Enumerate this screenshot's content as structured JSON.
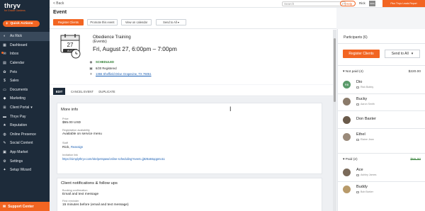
{
  "brand": {
    "logo": "thryv",
    "sub": "for Gracie Gardens"
  },
  "quick_actions": "Quick Actions",
  "nav": [
    {
      "label": "As Rick",
      "icon": "user-icon",
      "active": true
    },
    {
      "label": "Dashboard",
      "icon": "dashboard-icon",
      "active": false
    },
    {
      "label": "Inbox",
      "icon": "inbox-icon",
      "active": false,
      "badge": true
    },
    {
      "label": "Calendar",
      "icon": "calendar-icon",
      "active": false
    },
    {
      "label": "Pets",
      "icon": "paw-icon",
      "active": false
    },
    {
      "label": "Sales",
      "icon": "sales-icon",
      "active": false
    },
    {
      "label": "Documents",
      "icon": "documents-icon",
      "active": false
    },
    {
      "label": "Marketing",
      "icon": "marketing-icon",
      "active": false
    },
    {
      "label": "Client Portal",
      "icon": "portal-icon",
      "active": false,
      "caret": "▾"
    },
    {
      "label": "Thryv Pay",
      "icon": "pay-icon",
      "active": false
    },
    {
      "label": "Reputation",
      "icon": "reputation-icon",
      "active": false
    },
    {
      "label": "Online Presence",
      "icon": "presence-icon",
      "active": false
    },
    {
      "label": "Social Content",
      "icon": "social-icon",
      "active": false
    },
    {
      "label": "App Market",
      "icon": "market-icon",
      "active": false
    },
    {
      "label": "Settings",
      "icon": "gear-icon",
      "active": false
    },
    {
      "label": "Setup Wizard",
      "icon": "wizard-icon",
      "active": false
    }
  ],
  "support": "Support Center",
  "topbar": {
    "back": "< Back",
    "search_placeholder": "Search",
    "help": "? Help",
    "user": "Rick",
    "user_initials": "GMA",
    "promo": "Plus Thryv Leads Report"
  },
  "page_title": "Event",
  "header_buttons": [
    "Register Clients",
    "Promote this event",
    "View on calendar",
    "Send to All"
  ],
  "event": {
    "month": "AUG",
    "day": "27",
    "title": "Obedience Training",
    "subtitle": "(Events)",
    "date": "Fri, August 27, 6:00pm – 7:00pm",
    "status": "SCHEDULED",
    "registered": "6/20 Registered",
    "address": "1355 Sheffield Drive Grapevine, TX 76051"
  },
  "tabs": [
    "EDIT",
    "CANCEL EVENT",
    "DUPLICATE"
  ],
  "more_info": {
    "title": "More info",
    "price_label": "Price",
    "price": "$55.00 USD",
    "avail_label": "Registration availability",
    "avail": "Available on service menu",
    "staff_label": "Staff",
    "staff": "Rick,",
    "staff_link": "Reassign",
    "link_label": "Invitation link",
    "link": "https://simplythryv.com/site/petspaw/online-scheduling?event=jj8z8a84qqpmo11"
  },
  "notif": {
    "title": "Client notifications & follow ups",
    "confirm_label": "Booking confirmation",
    "confirm": "Email and text message",
    "reminder_label": "First reminder",
    "reminder": "15 minutes before (email and text message)"
  },
  "participants": {
    "title": "Participants (6)",
    "register": "Register Clients",
    "send": "Send to All",
    "not_paid": "Not paid (4)",
    "not_paid_amt": "$220.00",
    "paid": "Paid (2)",
    "paid_amt": "$55.00",
    "unpaid_list": [
      {
        "name": "Dio",
        "dep": "Rick Bobby",
        "initials": "RB"
      },
      {
        "name": "Bucky",
        "dep": "Aaron Smith"
      },
      {
        "name": "Don Baxter",
        "dep": ""
      },
      {
        "name": "Ethel",
        "dep": "Elaine Jean"
      }
    ],
    "paid_list": [
      {
        "name": "Ace",
        "dep": "Ashley James"
      },
      {
        "name": "Buddy",
        "dep": "Bob Barker"
      }
    ]
  },
  "colors": {
    "accent": "#f26522",
    "sidebar": "#1d2b3a",
    "status_green": "#2e7d32",
    "link": "#1a5fb4"
  }
}
